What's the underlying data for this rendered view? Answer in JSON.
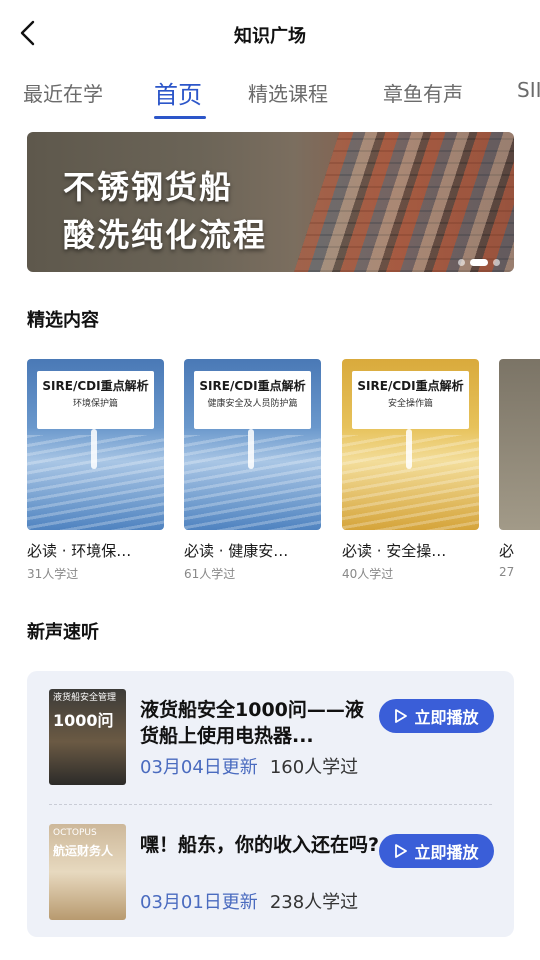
{
  "header": {
    "title": "知识广场",
    "back_icon": "chevron-left-icon"
  },
  "tabs": [
    {
      "label": "最近在学",
      "active": false
    },
    {
      "label": "首页",
      "active": true
    },
    {
      "label": "精选课程",
      "active": false
    },
    {
      "label": "章鱼有声",
      "active": false
    },
    {
      "label": "SII",
      "active": false
    }
  ],
  "banner": {
    "line1": "不锈钢货船",
    "line2": "酸洗纯化流程",
    "slides": 3,
    "active_slide": 2
  },
  "featured": {
    "section_title": "精选内容",
    "items": [
      {
        "cover_title": "SIRE/CDI重点解析",
        "cover_subtitle": "环境保护篇",
        "title": "必读 · 环境保…",
        "count": "31人学过",
        "cover_color": "blue"
      },
      {
        "cover_title": "SIRE/CDI重点解析",
        "cover_subtitle": "健康安全及人员防护篇",
        "title": "必读 · 健康安…",
        "count": "61人学过",
        "cover_color": "blue"
      },
      {
        "cover_title": "SIRE/CDI重点解析",
        "cover_subtitle": "安全操作篇",
        "title": "必读 · 安全操…",
        "count": "40人学过",
        "cover_color": "gold"
      },
      {
        "cover_title": "",
        "cover_subtitle": "",
        "title": "必",
        "count": "27",
        "cover_color": "grey"
      }
    ]
  },
  "audio": {
    "section_title": "新声速听",
    "play_label": "立即播放",
    "items": [
      {
        "thumb_label": "液货船安全管理",
        "thumb_big": "1000问",
        "title": "液货船安全1000问——液货船上使用电热器...",
        "date": "03月04日更新",
        "count": "160人学过"
      },
      {
        "thumb_label": "OCTOPUS",
        "thumb_big": "航运财务人",
        "title": "嘿！船东，你的收入还在吗?",
        "date": "03月01日更新",
        "count": "238人学过"
      }
    ]
  },
  "colors": {
    "accent": "#2c56c9",
    "button": "#3a5ed8",
    "panel": "#eef1f8",
    "date": "#4a6bbf"
  }
}
